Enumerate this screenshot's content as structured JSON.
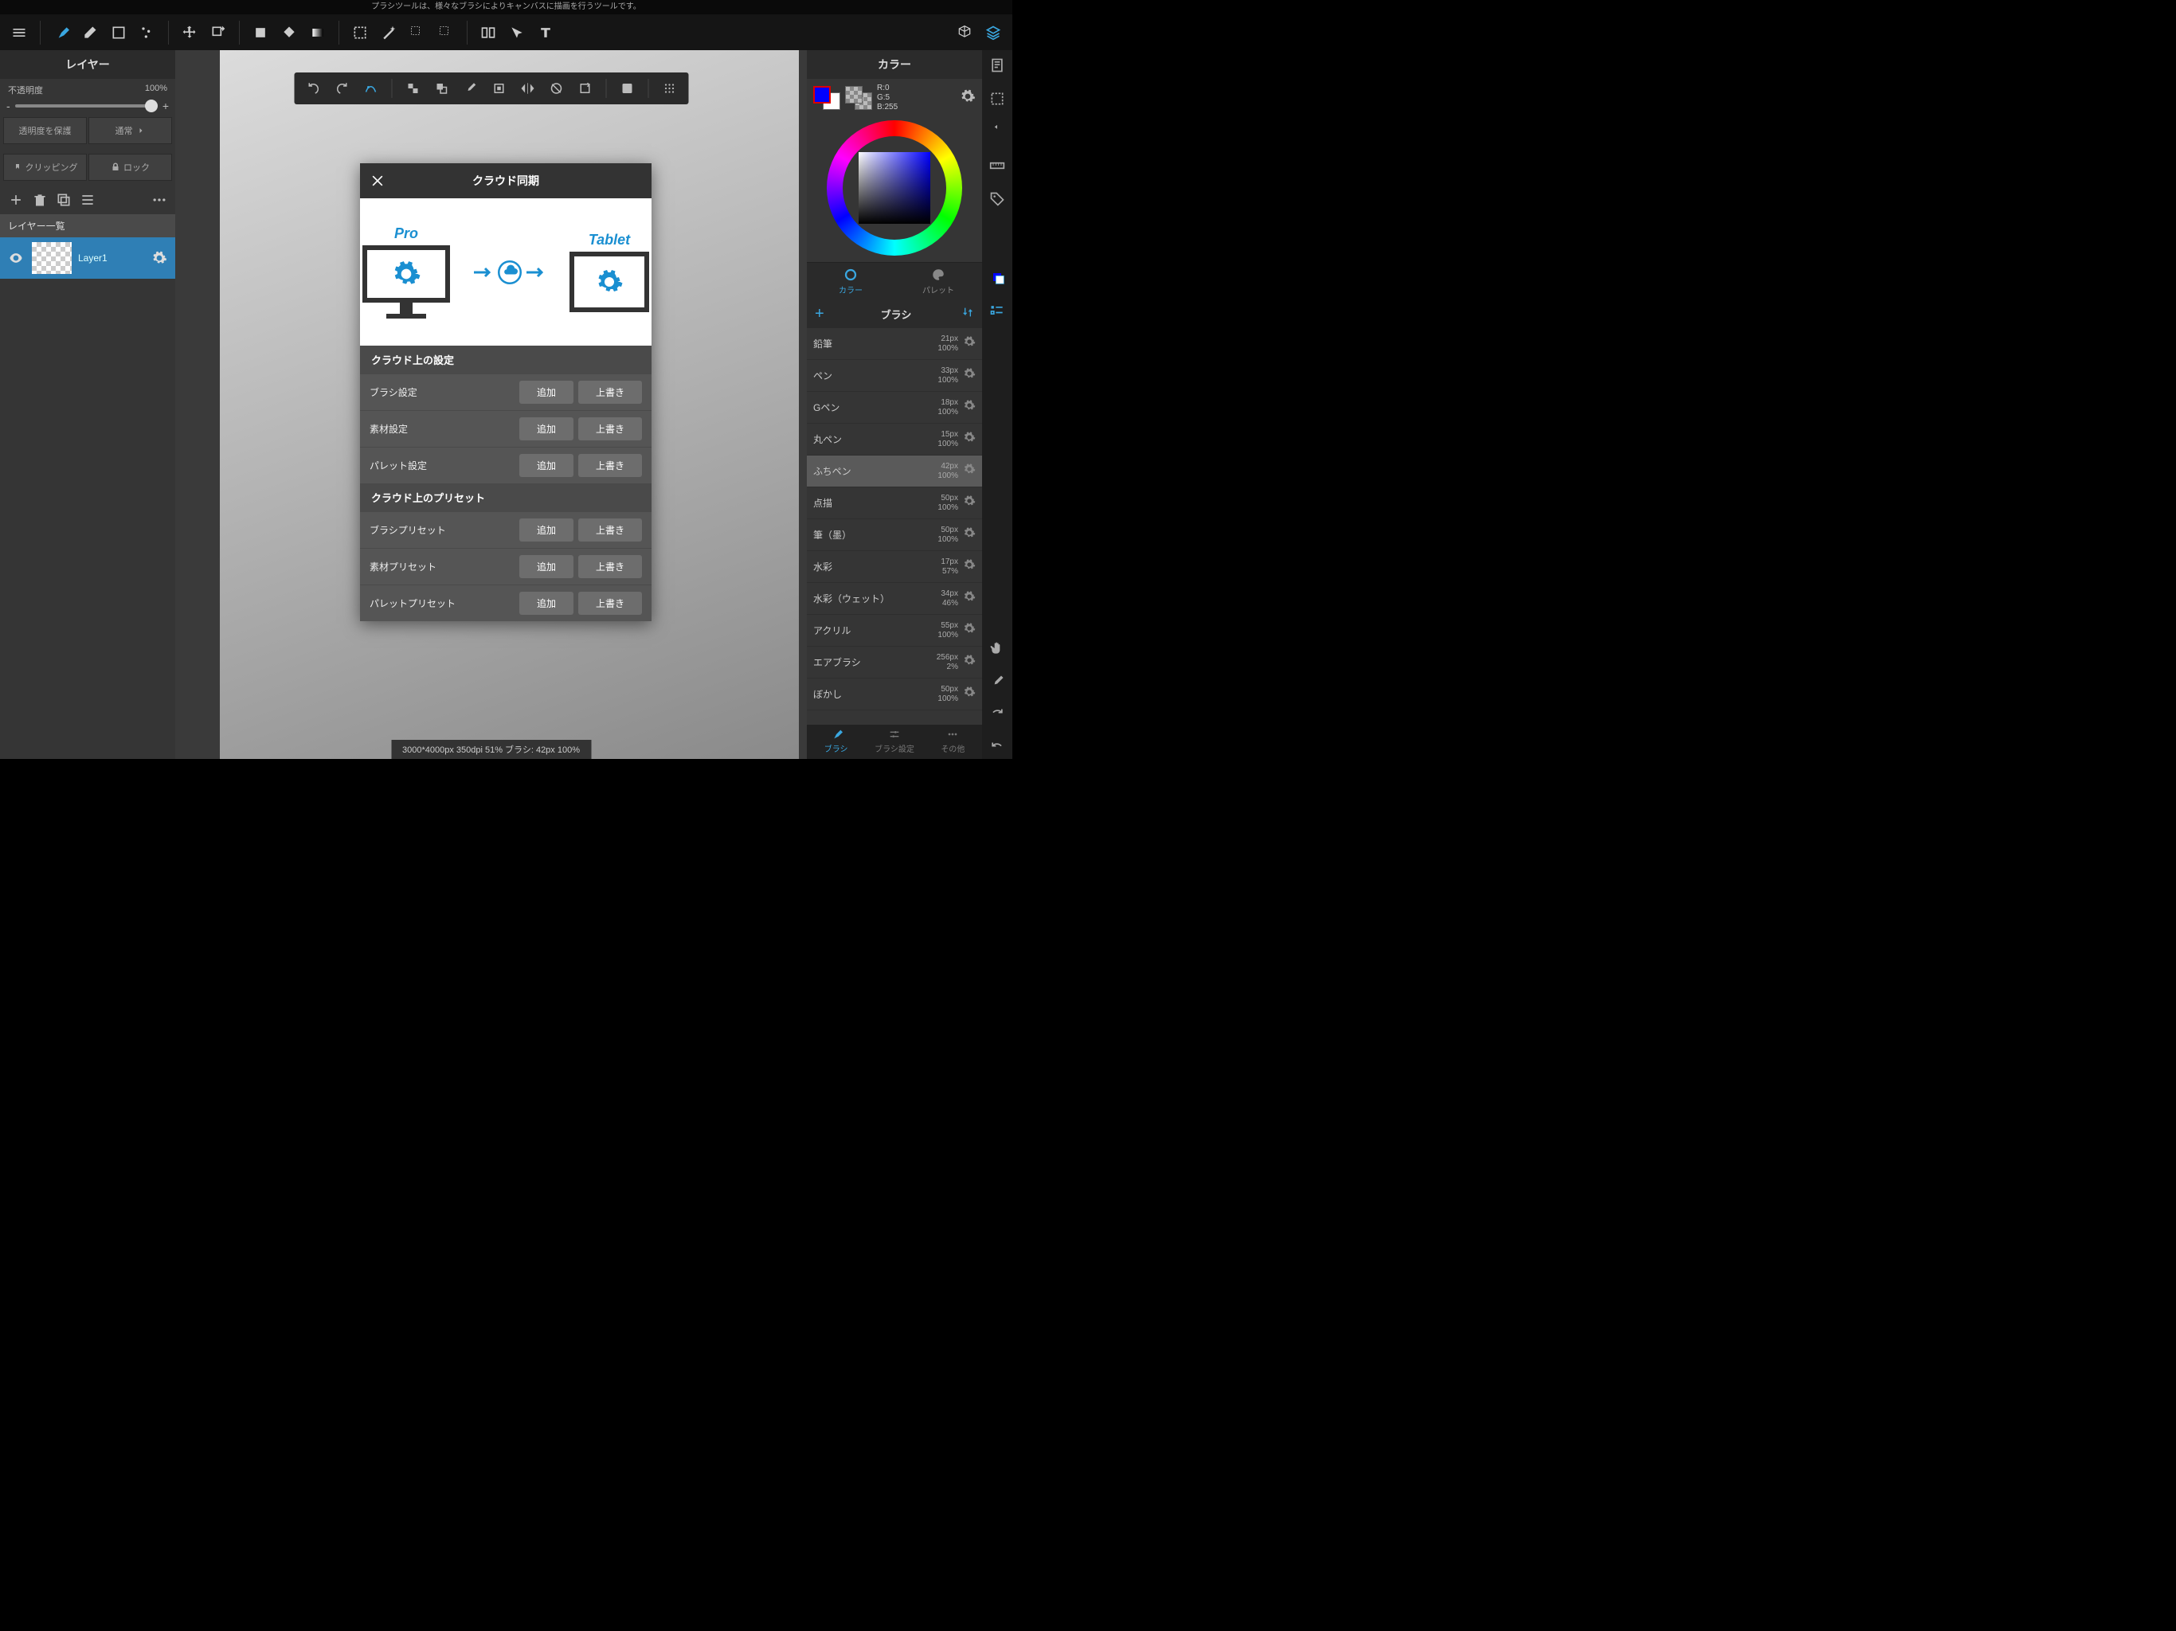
{
  "tipbar": "プラシツールは、様々なブラシによりキャンバスに描画を行うツールです。",
  "left": {
    "title": "レイヤー",
    "opacity_label": "不透明度",
    "opacity_value": "100%",
    "preserve_alpha": "透明度を保護",
    "blend_mode": "通常",
    "clipping": "クリッピング",
    "lock": "ロック",
    "list_header": "レイヤー一覧",
    "layer1_name": "Layer1"
  },
  "statusbar": "3000*4000px 350dpi 51% ブラシ: 42px 100%",
  "right": {
    "title": "カラー",
    "r": "R:0",
    "g": "G:5",
    "b": "B:255",
    "tab_color": "カラー",
    "tab_palette": "パレット",
    "brush_title": "ブラシ",
    "brushes": [
      {
        "name": "鉛筆",
        "size": "21px",
        "op": "100%"
      },
      {
        "name": "ペン",
        "size": "33px",
        "op": "100%"
      },
      {
        "name": "Gペン",
        "size": "18px",
        "op": "100%"
      },
      {
        "name": "丸ペン",
        "size": "15px",
        "op": "100%"
      },
      {
        "name": "ふちペン",
        "size": "42px",
        "op": "100%"
      },
      {
        "name": "点描",
        "size": "50px",
        "op": "100%"
      },
      {
        "name": "筆（墨）",
        "size": "50px",
        "op": "100%"
      },
      {
        "name": "水彩",
        "size": "17px",
        "op": "57%"
      },
      {
        "name": "水彩（ウェット）",
        "size": "34px",
        "op": "46%"
      },
      {
        "name": "アクリル",
        "size": "55px",
        "op": "100%"
      },
      {
        "name": "エアブラシ",
        "size": "256px",
        "op": "2%"
      },
      {
        "name": "ぼかし",
        "size": "50px",
        "op": "100%"
      }
    ],
    "btab_brush": "ブラシ",
    "btab_settings": "ブラシ設定",
    "btab_other": "その他"
  },
  "modal": {
    "title": "クラウド同期",
    "pro": "Pro",
    "tablet": "Tablet",
    "section1": "クラウド上の設定",
    "section2": "クラウド上のプリセット",
    "add": "追加",
    "overwrite": "上書き",
    "rows1": [
      "ブラシ設定",
      "素材設定",
      "パレット設定"
    ],
    "rows2": [
      "ブラシプリセット",
      "素材プリセット",
      "パレットプリセット"
    ]
  }
}
